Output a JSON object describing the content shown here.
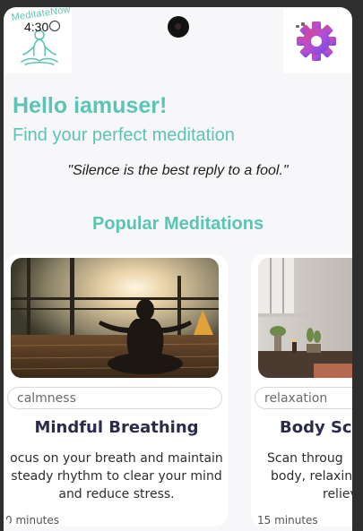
{
  "header": {
    "logo_text": "MeditateNow",
    "status_time": "4:30"
  },
  "greeting": "Hello iamuser!",
  "subtitle": "Find your perfect meditation",
  "quote": "\"Silence is the best reply to a fool.\"",
  "section_title": "Popular Meditations",
  "cards": [
    {
      "tag": "calmness",
      "title": "Mindful Breathing",
      "description_lines": [
        "ocus on your breath and maintain",
        "steady rhythm to clear your mind",
        "and reduce stress."
      ],
      "duration": "0 minutes"
    },
    {
      "tag": "relaxation",
      "title": "Body Sc",
      "description_lines": [
        "Scan throug",
        "body, relaxin",
        "reliev"
      ],
      "duration": "15 minutes"
    }
  ],
  "colors": {
    "accent": "#5cc4b4",
    "title_text": "#2b2b4a",
    "background": "#f7f7f9"
  },
  "icons": {
    "logo": "meditation-figure-icon",
    "settings": "gear-icon"
  }
}
